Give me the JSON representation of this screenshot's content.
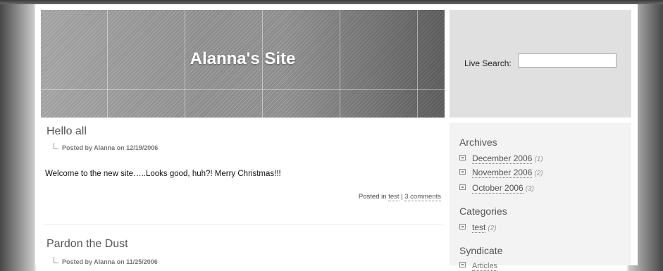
{
  "site": {
    "title": "Alanna's Site"
  },
  "search": {
    "label": "Live Search:",
    "value": "",
    "placeholder": ""
  },
  "posts": [
    {
      "title": "Hello all",
      "meta": "Posted by Alanna on 12/19/2006",
      "body": "Welcome to the new site…..Looks good, huh?! Merry Christmas!!!",
      "footer_prefix": "Posted in",
      "category_link": "test",
      "separator": "|",
      "comments_link": "3 comments"
    },
    {
      "title": "Pardon the Dust",
      "meta": "Posted by Alanna on 11/25/2006"
    }
  ],
  "sidebar": {
    "archives": {
      "heading": "Archives",
      "items": [
        {
          "label": "December 2006",
          "count": "(1)"
        },
        {
          "label": "November 2006",
          "count": "(2)"
        },
        {
          "label": "October 2006",
          "count": "(3)"
        }
      ]
    },
    "categories": {
      "heading": "Categories",
      "items": [
        {
          "label": "test",
          "count": "(2)"
        }
      ]
    },
    "syndicate": {
      "heading": "Syndicate",
      "items": [
        {
          "label": "Articles"
        }
      ]
    }
  }
}
